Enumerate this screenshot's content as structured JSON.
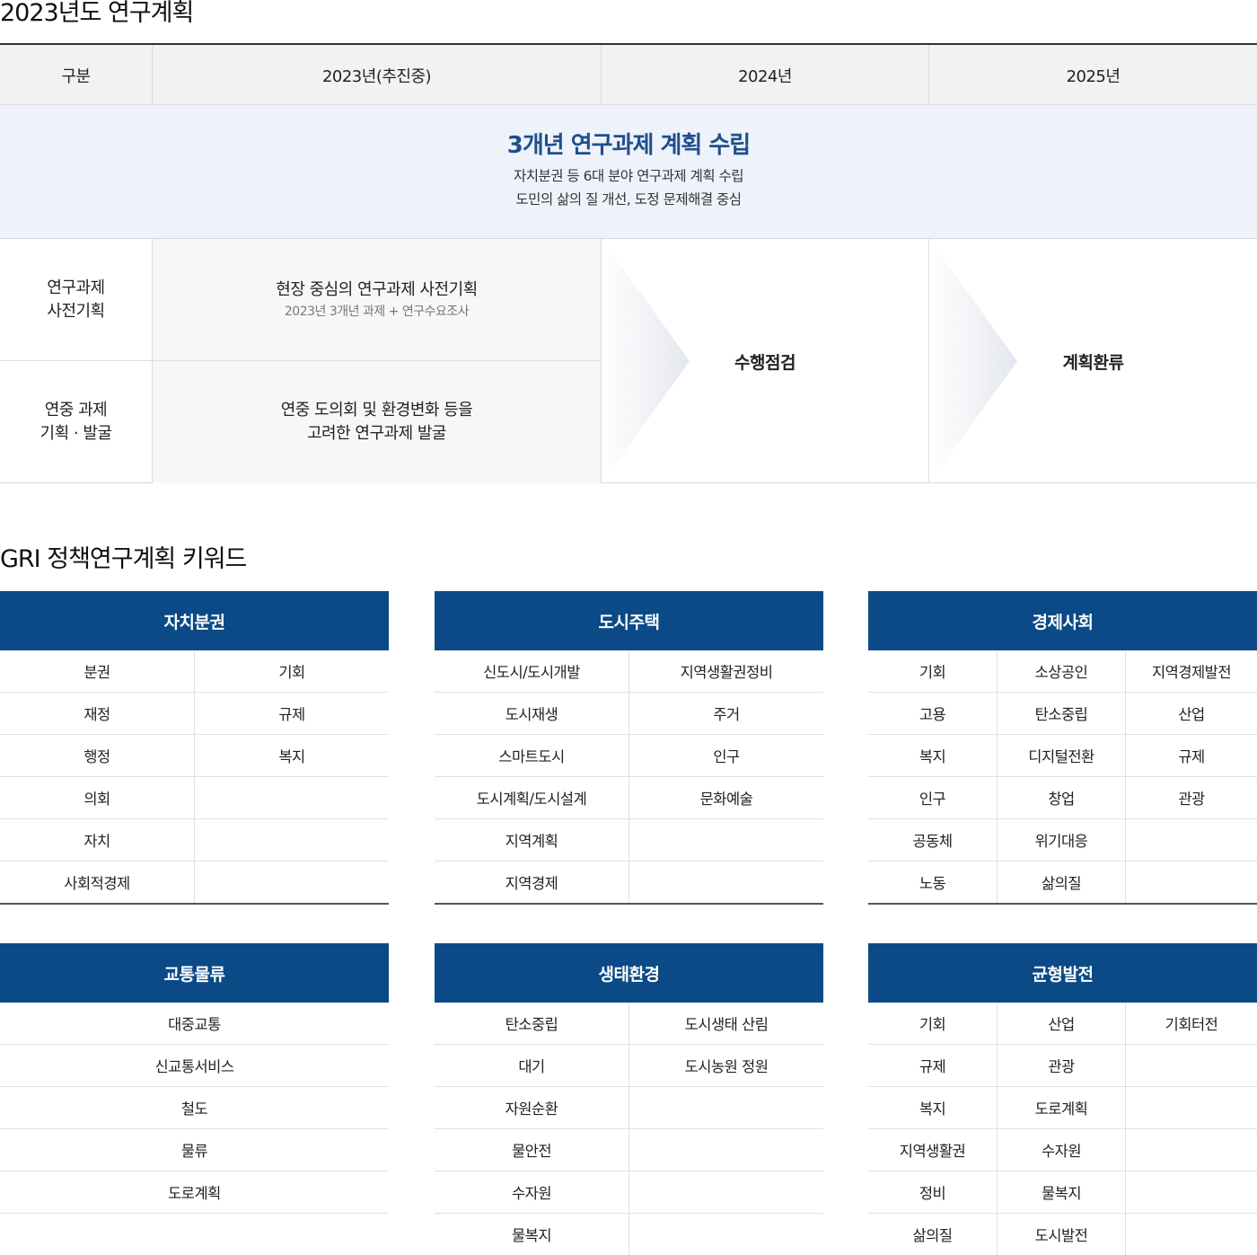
{
  "section1_title": "2023년도 연구계획",
  "plan": {
    "header": [
      "구분",
      "2023년(추진중)",
      "2024년",
      "2025년"
    ],
    "banner": {
      "title": "3개년 연구과제 계획 수립",
      "line1": "자치분권 등 6대 분야 연구과제 계획 수립",
      "line2": "도민의 삶의 질 개선, 도정 문제해결 중심"
    },
    "row1": {
      "label_line1": "연구과제",
      "label_line2": "사전기획",
      "main": "현장 중심의 연구과제 사전기획",
      "sub": "2023년 3개년 과제 + 연구수요조사"
    },
    "row2": {
      "label_line1": "연중 과제",
      "label_line2": "기획 · 발굴",
      "main_line1": "연중 도의회 및 환경변화 등을",
      "main_line2": "고려한 연구과제 발굴"
    },
    "stage_2024": "수행점검",
    "stage_2025": "계획환류"
  },
  "section2_title": "GRI 정책연구계획 키워드",
  "keyword_tables": [
    {
      "title": "자치분권",
      "columns": 2,
      "rows": [
        [
          "분권",
          "기회"
        ],
        [
          "재정",
          "규제"
        ],
        [
          "행정",
          "복지"
        ],
        [
          "의회",
          ""
        ],
        [
          "자치",
          ""
        ],
        [
          "사회적경제",
          ""
        ]
      ]
    },
    {
      "title": "도시주택",
      "columns": 2,
      "rows": [
        [
          "신도시/도시개발",
          "지역생활권정비"
        ],
        [
          "도시재생",
          "주거"
        ],
        [
          "스마트도시",
          "인구"
        ],
        [
          "도시계획/도시설계",
          "문화예술"
        ],
        [
          "지역계획",
          ""
        ],
        [
          "지역경제",
          ""
        ]
      ]
    },
    {
      "title": "경제사회",
      "columns": 3,
      "rows": [
        [
          "기회",
          "소상공인",
          "지역경제발전"
        ],
        [
          "고용",
          "탄소중립",
          "산업"
        ],
        [
          "복지",
          "디지털전환",
          "규제"
        ],
        [
          "인구",
          "창업",
          "관광"
        ],
        [
          "공동체",
          "위기대응",
          ""
        ],
        [
          "노동",
          "삶의질",
          ""
        ]
      ]
    },
    {
      "title": "교통물류",
      "columns": 1,
      "rows": [
        [
          "대중교통"
        ],
        [
          "신교통서비스"
        ],
        [
          "철도"
        ],
        [
          "물류"
        ],
        [
          "도로계획"
        ],
        [
          ""
        ]
      ]
    },
    {
      "title": "생태환경",
      "columns": 2,
      "rows": [
        [
          "탄소중립",
          "도시생태 산림"
        ],
        [
          "대기",
          "도시농원 정원"
        ],
        [
          "자원순환",
          ""
        ],
        [
          "물안전",
          ""
        ],
        [
          "수자원",
          ""
        ],
        [
          "물복지",
          ""
        ]
      ]
    },
    {
      "title": "균형발전",
      "columns": 3,
      "rows": [
        [
          "기회",
          "산업",
          "기회터전"
        ],
        [
          "규제",
          "관광",
          ""
        ],
        [
          "복지",
          "도로계획",
          ""
        ],
        [
          "지역생활권",
          "수자원",
          ""
        ],
        [
          "정비",
          "물복지",
          ""
        ],
        [
          "삶의질",
          "도시발전",
          ""
        ]
      ]
    }
  ],
  "colors": {
    "header_blue": "#0b4a86",
    "banner_title": "#1f4f8c",
    "banner_bg": "#eef2fa"
  }
}
